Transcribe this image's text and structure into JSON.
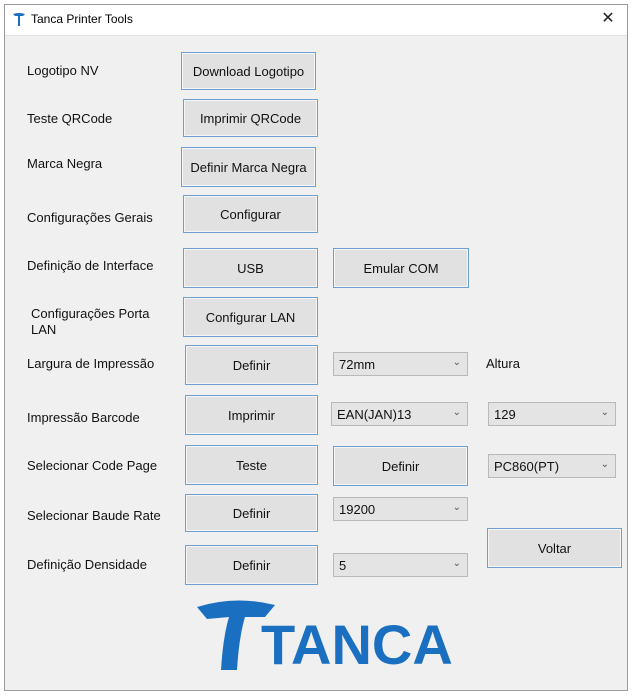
{
  "window": {
    "title": "Tanca Printer Tools",
    "close_glyph": "✕",
    "app_icon": "tanca-t-icon"
  },
  "rows": {
    "logotipo": {
      "label": "Logotipo NV",
      "button": "Download Logotipo"
    },
    "qrcode": {
      "label": "Teste QRCode",
      "button": "Imprimir QRCode"
    },
    "marca": {
      "label": "Marca Negra",
      "button": "Definir Marca Negra"
    },
    "config": {
      "label": "Configurações Gerais",
      "button": "Configurar"
    },
    "interface": {
      "label": "Definição de Interface",
      "button_usb": "USB",
      "button_com": "Emular COM"
    },
    "lan": {
      "label": "Configurações Porta LAN",
      "button": "Configurar LAN"
    },
    "largura": {
      "label": "Largura de Impressão",
      "button": "Definir",
      "select": "72mm",
      "altura_label": "Altura"
    },
    "barcode": {
      "label": "Impressão Barcode",
      "button": "Imprimir",
      "select_type": "EAN(JAN)13",
      "select_value": "129"
    },
    "codepage": {
      "label": "Selecionar Code Page",
      "button_teste": "Teste",
      "button_definir": "Definir",
      "select": "PC860(PT)"
    },
    "baude": {
      "label": "Selecionar Baude Rate",
      "button": "Definir",
      "select": "19200"
    },
    "densidade": {
      "label": "Definição Densidade",
      "button": "Definir",
      "select": "5"
    }
  },
  "voltar_button": "Voltar",
  "logo": {
    "text": "TANCA",
    "color": "#1b6fc0"
  },
  "chevron_glyph": "⌄"
}
